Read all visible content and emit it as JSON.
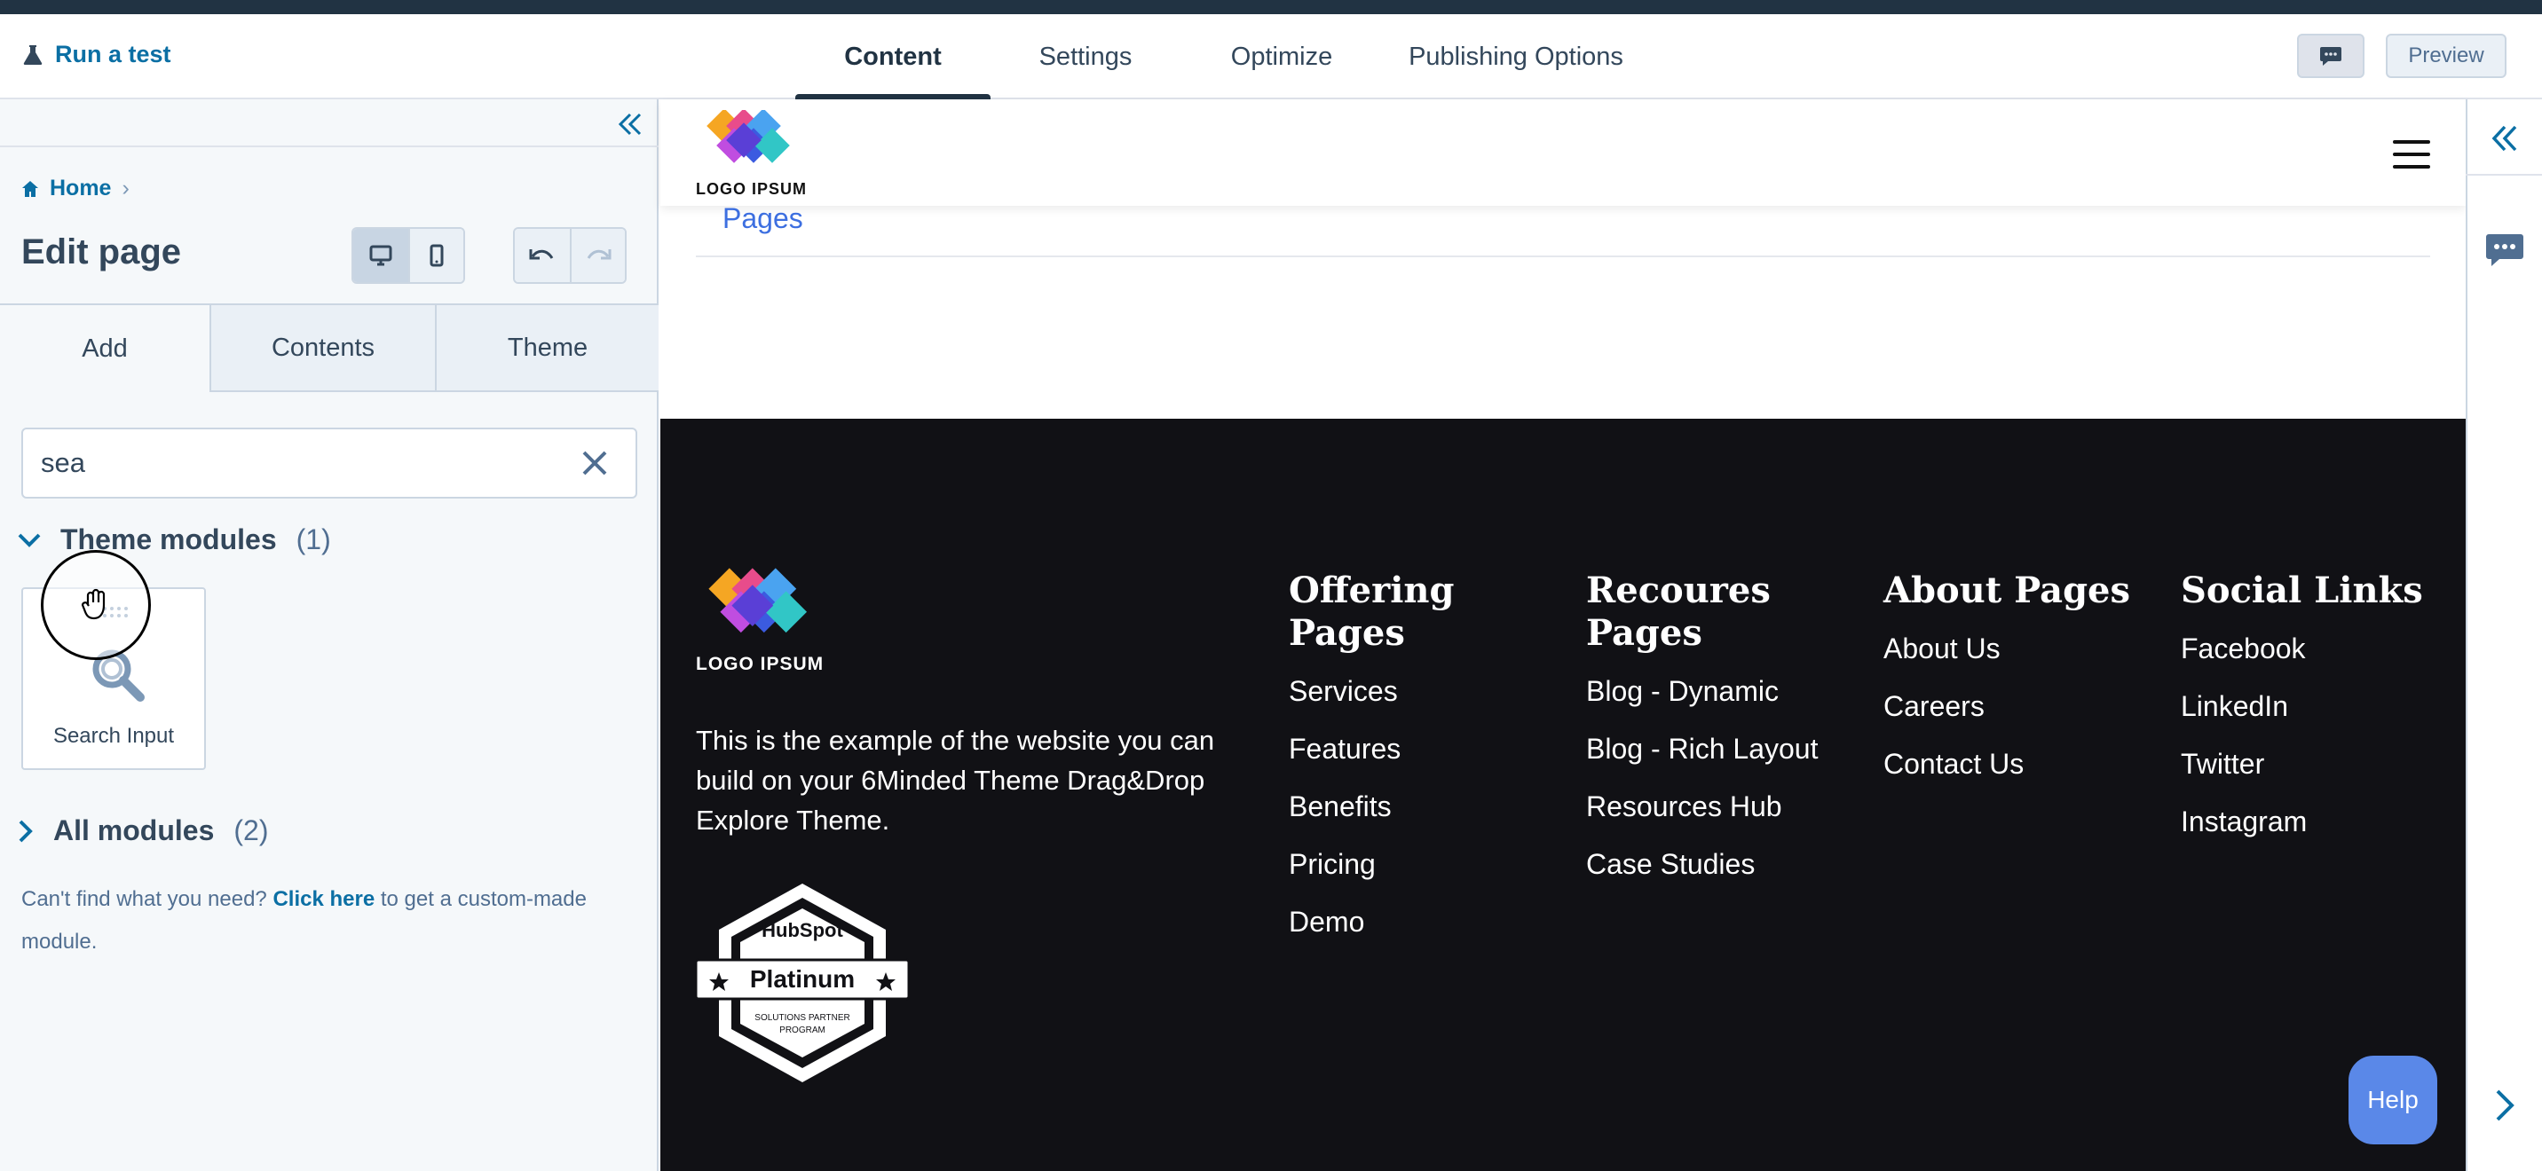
{
  "topbar": {
    "run_test": "Run a test",
    "tabs": [
      {
        "label": "Content",
        "active": true
      },
      {
        "label": "Settings",
        "active": false
      },
      {
        "label": "Optimize",
        "active": false
      },
      {
        "label": "Publishing Options",
        "active": false
      }
    ],
    "preview_label": "Preview",
    "comment_icon": "comment-icon"
  },
  "sidebar": {
    "breadcrumb": {
      "home": "Home",
      "separator": "›"
    },
    "title": "Edit page",
    "tabs": [
      {
        "label": "Add",
        "active": true
      },
      {
        "label": "Contents",
        "active": false
      },
      {
        "label": "Theme",
        "active": false
      }
    ],
    "search": {
      "value": "sea"
    },
    "theme_modules": {
      "label": "Theme modules",
      "count": "(1)",
      "expanded": true
    },
    "module_card": {
      "label": "Search Input",
      "icon": "magnifier-icon"
    },
    "all_modules": {
      "label": "All modules",
      "count": "(2)",
      "expanded": false
    },
    "help": {
      "before": "Can't find what you need?",
      "link": "Click here",
      "after": "to get a custom-made module."
    }
  },
  "canvas": {
    "header": {
      "logo_text": "LOGO IPSUM"
    },
    "pages_link": "Pages",
    "footer": {
      "logo_text": "LOGO IPSUM",
      "description": "This is the example of the website you can build on your 6Minded Theme Drag&Drop Explore Theme.",
      "badge": {
        "brand": "HubSpot",
        "tier": "Platinum",
        "sub1": "SOLUTIONS PARTNER",
        "sub2": "PROGRAM"
      },
      "columns": [
        {
          "title": "Offering Pages",
          "links": [
            "Services",
            "Features",
            "Benefits",
            "Pricing",
            "Demo"
          ]
        },
        {
          "title": "Recoures Pages",
          "links": [
            "Blog - Dynamic",
            "Blog - Rich Layout",
            "Resources Hub",
            "Case Studies"
          ]
        },
        {
          "title": "About Pages",
          "links": [
            "About Us",
            "Careers",
            "Contact Us"
          ]
        },
        {
          "title": "Social Links",
          "links": [
            "Facebook",
            "LinkedIn",
            "Twitter",
            "Instagram"
          ]
        }
      ]
    },
    "help_button": "Help"
  },
  "colors": {
    "accent": "#0b6fa4",
    "dark": "#213343",
    "footer_bg": "#111115",
    "link_blue": "#3d6fe0",
    "help_button": "#5a88e8"
  }
}
